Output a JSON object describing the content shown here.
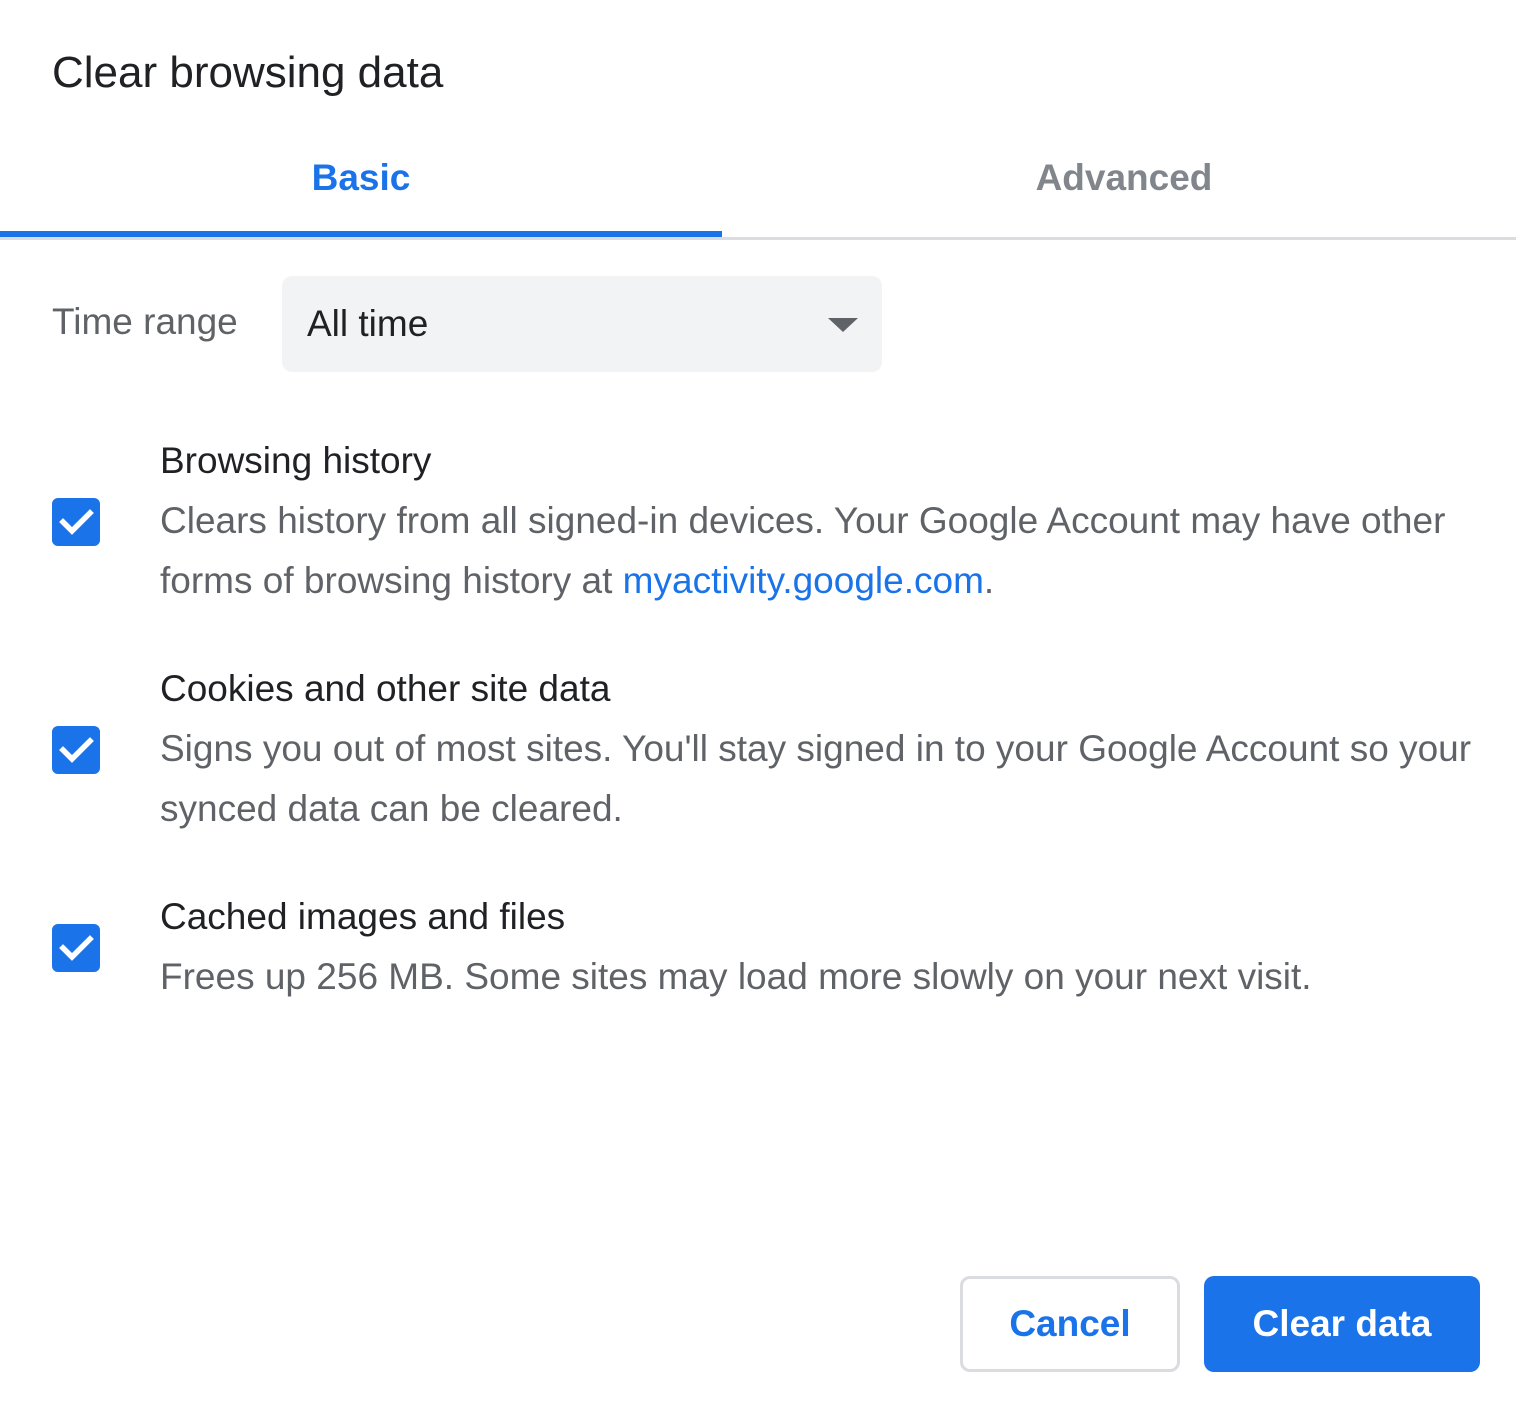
{
  "dialog": {
    "title": "Clear browsing data"
  },
  "tabs": [
    {
      "label": "Basic",
      "active": true
    },
    {
      "label": "Advanced",
      "active": false
    }
  ],
  "time_range": {
    "label": "Time range",
    "selected": "All time"
  },
  "items": [
    {
      "title": "Browsing history",
      "description_before_link": "Clears history from all signed-in devices. Your Google Account may have other forms of browsing history at ",
      "link_text": "myactivity.google.com",
      "description_after_link": ".",
      "checked": true
    },
    {
      "title": "Cookies and other site data",
      "description": "Signs you out of most sites. You'll stay signed in to your Google Account so your synced data can be cleared.",
      "checked": true
    },
    {
      "title": "Cached images and files",
      "description": "Frees up 256 MB. Some sites may load more slowly on your next visit.",
      "checked": true
    }
  ],
  "buttons": {
    "cancel": "Cancel",
    "clear": "Clear data"
  },
  "colors": {
    "accent": "#1a73e8",
    "secondary_text": "#5f6368",
    "inactive_tab": "#80868b",
    "select_bg": "#f1f3f4",
    "divider": "#dadce0"
  }
}
